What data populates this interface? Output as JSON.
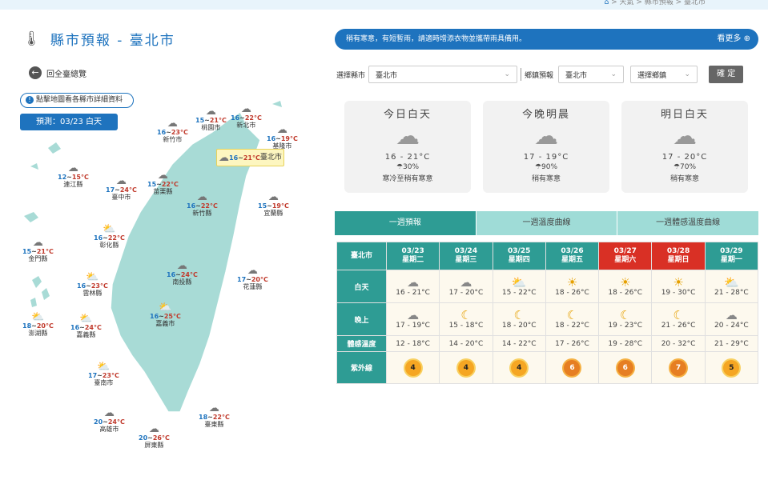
{
  "breadcrumb": {
    "home": "⌂",
    "path": "> 天氣 > 縣市預報 > 臺北市"
  },
  "page": {
    "title": "縣市預報 - 臺北市",
    "back_label": "回全臺總覽",
    "hint": "點擊地圖看各縣市詳細資料",
    "forecast_label": "預測：03/23 白天"
  },
  "banner": {
    "text": "稍有寒意，有短暫雨，請適時增添衣物並攜帶雨具備用。",
    "more": "看更多"
  },
  "selectors": {
    "county_label": "選擇縣市",
    "county_value": "臺北市",
    "town_label": "鄉鎮預報",
    "town_county": "臺北市",
    "town_value": "選擇鄉鎮",
    "confirm": "確 定"
  },
  "cards": [
    {
      "title": "今日白天",
      "temp": "16 - 21°C",
      "rain": "☂30%",
      "desc": "寒冷至稍有寒意"
    },
    {
      "title": "今晚明晨",
      "temp": "17 - 19°C",
      "rain": "☂90%",
      "desc": "稍有寒意"
    },
    {
      "title": "明日白天",
      "temp": "17 - 20°C",
      "rain": "☂70%",
      "desc": "稍有寒意"
    }
  ],
  "tabs": [
    "一週預報",
    "一週溫度曲線",
    "一週體感溫度曲線"
  ],
  "week": {
    "corner": "臺北市",
    "days": [
      {
        "date": "03/23",
        "weekday": "星期二",
        "weekend": false
      },
      {
        "date": "03/24",
        "weekday": "星期三",
        "weekend": false
      },
      {
        "date": "03/25",
        "weekday": "星期四",
        "weekend": false
      },
      {
        "date": "03/26",
        "weekday": "星期五",
        "weekend": false
      },
      {
        "date": "03/27",
        "weekday": "星期六",
        "weekend": true
      },
      {
        "date": "03/28",
        "weekday": "星期日",
        "weekend": true
      },
      {
        "date": "03/29",
        "weekday": "星期一",
        "weekend": false
      }
    ],
    "rows": {
      "day_label": "白天",
      "day": [
        "16 - 21°C",
        "17 - 20°C",
        "15 - 22°C",
        "18 - 26°C",
        "18 - 26°C",
        "19 - 30°C",
        "21 - 28°C"
      ],
      "day_icons": [
        "rain-cloud",
        "rain-cloud",
        "partly-sunny",
        "sunny",
        "sunny",
        "sunny",
        "partly-sunny"
      ],
      "night_label": "晚上",
      "night": [
        "17 - 19°C",
        "15 - 18°C",
        "18 - 20°C",
        "18 - 22°C",
        "19 - 23°C",
        "21 - 26°C",
        "20 - 24°C"
      ],
      "night_icons": [
        "rain-cloud",
        "moon",
        "moon",
        "moon",
        "moon",
        "moon",
        "cloudy-moon"
      ],
      "feel_label": "體感溫度",
      "feel": [
        "12 - 18°C",
        "14 - 20°C",
        "14 - 22°C",
        "17 - 26°C",
        "19 - 28°C",
        "20 - 32°C",
        "21 - 29°C"
      ],
      "uv_label": "紫外線",
      "uv": [
        "4",
        "4",
        "4",
        "6",
        "6",
        "7",
        "5"
      ]
    }
  },
  "map_cities": [
    {
      "name": "新北市",
      "lo": "16",
      "hi": "22°C"
    },
    {
      "name": "桃園市",
      "lo": "15",
      "hi": "21°C"
    },
    {
      "name": "新竹市",
      "lo": "16",
      "hi": "23°C"
    },
    {
      "name": "基隆市",
      "lo": "16",
      "hi": "19°C"
    },
    {
      "name": "臺北市",
      "lo": "16",
      "hi": "21°C"
    },
    {
      "name": "連江縣",
      "lo": "12",
      "hi": "15°C"
    },
    {
      "name": "苗栗縣",
      "lo": "15",
      "hi": "22°C"
    },
    {
      "name": "臺中市",
      "lo": "17",
      "hi": "24°C"
    },
    {
      "name": "新竹縣",
      "lo": "16",
      "hi": "22°C"
    },
    {
      "name": "宜蘭縣",
      "lo": "15",
      "hi": "19°C"
    },
    {
      "name": "彰化縣",
      "lo": "16",
      "hi": "22°C"
    },
    {
      "name": "金門縣",
      "lo": "15",
      "hi": "21°C"
    },
    {
      "name": "南投縣",
      "lo": "16",
      "hi": "24°C"
    },
    {
      "name": "雲林縣",
      "lo": "16",
      "hi": "23°C"
    },
    {
      "name": "花蓮縣",
      "lo": "17",
      "hi": "20°C"
    },
    {
      "name": "嘉義市",
      "lo": "16",
      "hi": "25°C"
    },
    {
      "name": "澎湖縣",
      "lo": "18",
      "hi": "20°C"
    },
    {
      "name": "嘉義縣",
      "lo": "16",
      "hi": "24°C"
    },
    {
      "name": "臺南市",
      "lo": "17",
      "hi": "23°C"
    },
    {
      "name": "高雄市",
      "lo": "20",
      "hi": "24°C"
    },
    {
      "name": "臺東縣",
      "lo": "18",
      "hi": "22°C"
    },
    {
      "name": "屏東縣",
      "lo": "20",
      "hi": "26°C"
    }
  ],
  "colors": {
    "primary": "#1e73be",
    "teal": "#2e9c94",
    "weekend": "#d93025",
    "map_land": "#a8dbd6"
  }
}
